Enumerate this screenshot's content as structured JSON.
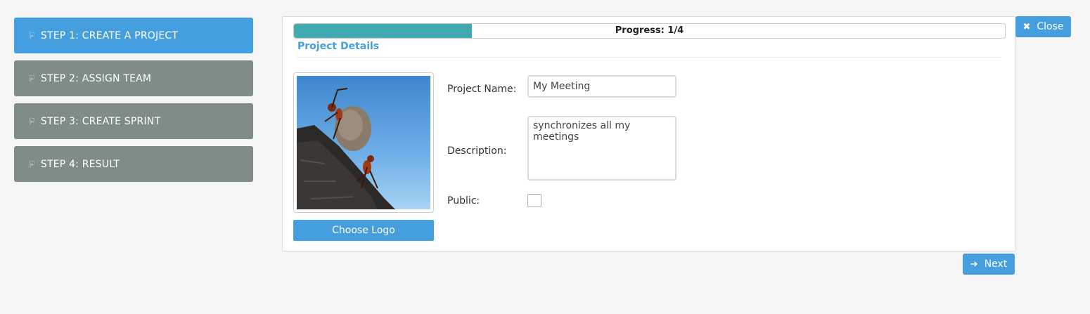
{
  "steps": [
    {
      "label": "STEP 1: CREATE A PROJECT",
      "active": true
    },
    {
      "label": "STEP 2: ASSIGN TEAM",
      "active": false
    },
    {
      "label": "STEP 3: CREATE SPRINT",
      "active": false
    },
    {
      "label": "STEP 4: RESULT",
      "active": false
    }
  ],
  "progress": {
    "text": "Progress: 1/4",
    "fraction": 0.25
  },
  "section": {
    "title": "Project Details"
  },
  "logo": {
    "button_label": "Choose Logo"
  },
  "form": {
    "project_name_label": "Project Name:",
    "project_name_value": "My Meeting",
    "description_label": "Description:",
    "description_value": "synchronizes all my meetings",
    "public_label": "Public:",
    "public_checked": false
  },
  "buttons": {
    "close_label": "Close",
    "next_label": "Next"
  },
  "colors": {
    "accent": "#459fde",
    "step_inactive": "#7f8c8a",
    "progress_fill": "#41aab0"
  },
  "icons": {
    "step": "hand-point-icon",
    "close": "close-icon",
    "next": "arrow-right-icon"
  }
}
